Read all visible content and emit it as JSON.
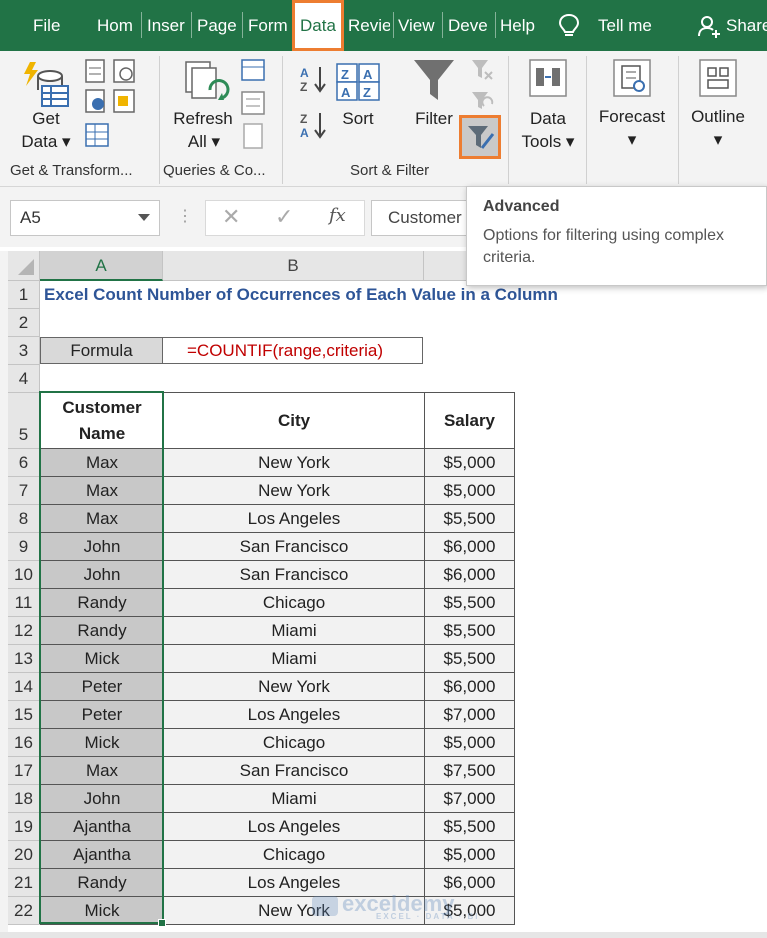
{
  "ribbon_tabs": [
    {
      "label": "File"
    },
    {
      "label": "Hom"
    },
    {
      "label": "Inser"
    },
    {
      "label": "Page"
    },
    {
      "label": "Form"
    },
    {
      "label": "Data"
    },
    {
      "label": "Reviе"
    },
    {
      "label": "View"
    },
    {
      "label": "Deve"
    },
    {
      "label": "Help"
    },
    {
      "label": "Tell me"
    },
    {
      "label": "Share"
    }
  ],
  "active_tab": "Data",
  "colors": {
    "excel_green": "#217346",
    "highlight_orange": "#ed7d31",
    "title_blue": "#2e5597",
    "formula_red": "#c00000"
  },
  "ribbon": {
    "get_data": {
      "line1": "Get",
      "line2": "Data ▾"
    },
    "refresh_all": {
      "line1": "Refresh",
      "line2": "All ▾"
    },
    "sort_label": "Sort",
    "filter_label": "Filter",
    "data_tools": {
      "line1": "Data",
      "line2": "Tools ▾"
    },
    "forecast": {
      "line1": "Forecast",
      "line2": "▾"
    },
    "outline": {
      "line1": "Outline",
      "line2": "▾"
    },
    "groups": {
      "get_transform": "Get & Transform...",
      "queries": "Queries & Co...",
      "sort_filter": "Sort & Filter"
    }
  },
  "formula_bar": {
    "name_box": "A5",
    "cancel": "✕",
    "enter": "✓",
    "fx": "fx",
    "content": "Customer"
  },
  "tooltip": {
    "title": "Advanced",
    "body": "Options for filtering using complex criteria."
  },
  "columns": [
    "A",
    "B"
  ],
  "rows": [
    "1",
    "2",
    "3",
    "4",
    "5",
    "6",
    "7",
    "8",
    "9",
    "10",
    "11",
    "12",
    "13",
    "14",
    "15",
    "16",
    "17",
    "18",
    "19",
    "20",
    "21",
    "22"
  ],
  "sheet": {
    "title": "Excel Count Number of Occurrences of Each Value in a Column",
    "formula_label": "Formula",
    "formula_value": "=COUNTIF(range,criteria)",
    "headers": {
      "name_line1": "Customer",
      "name_line2": "Name",
      "city": "City",
      "salary": "Salary"
    },
    "records": [
      {
        "name": "Max",
        "city": "New York",
        "salary": "$5,000"
      },
      {
        "name": "Max",
        "city": "New York",
        "salary": "$5,000"
      },
      {
        "name": "Max",
        "city": "Los Angeles",
        "salary": "$5,500"
      },
      {
        "name": "John",
        "city": "San Francisco",
        "salary": "$6,000"
      },
      {
        "name": "John",
        "city": "San Francisco",
        "salary": "$6,000"
      },
      {
        "name": "Randy",
        "city": "Chicago",
        "salary": "$5,500"
      },
      {
        "name": "Randy",
        "city": "Miami",
        "salary": "$5,500"
      },
      {
        "name": "Mick",
        "city": "Miami",
        "salary": "$5,500"
      },
      {
        "name": "Peter",
        "city": "New York",
        "salary": "$6,000"
      },
      {
        "name": "Peter",
        "city": "Los Angeles",
        "salary": "$7,000"
      },
      {
        "name": "Mick",
        "city": "Chicago",
        "salary": "$5,000"
      },
      {
        "name": "Max",
        "city": "San Francisco",
        "salary": "$7,500"
      },
      {
        "name": "John",
        "city": "Miami",
        "salary": "$7,000"
      },
      {
        "name": "Ajantha",
        "city": "Los Angeles",
        "salary": "$5,500"
      },
      {
        "name": "Ajantha",
        "city": "Chicago",
        "salary": "$5,000"
      },
      {
        "name": "Randy",
        "city": "Los Angeles",
        "salary": "$6,000"
      },
      {
        "name": "Mick",
        "city": "New York",
        "salary": "$5,000"
      }
    ]
  },
  "watermark": {
    "brand": "exceldemy",
    "tagline": "EXCEL · DATA · BI"
  }
}
